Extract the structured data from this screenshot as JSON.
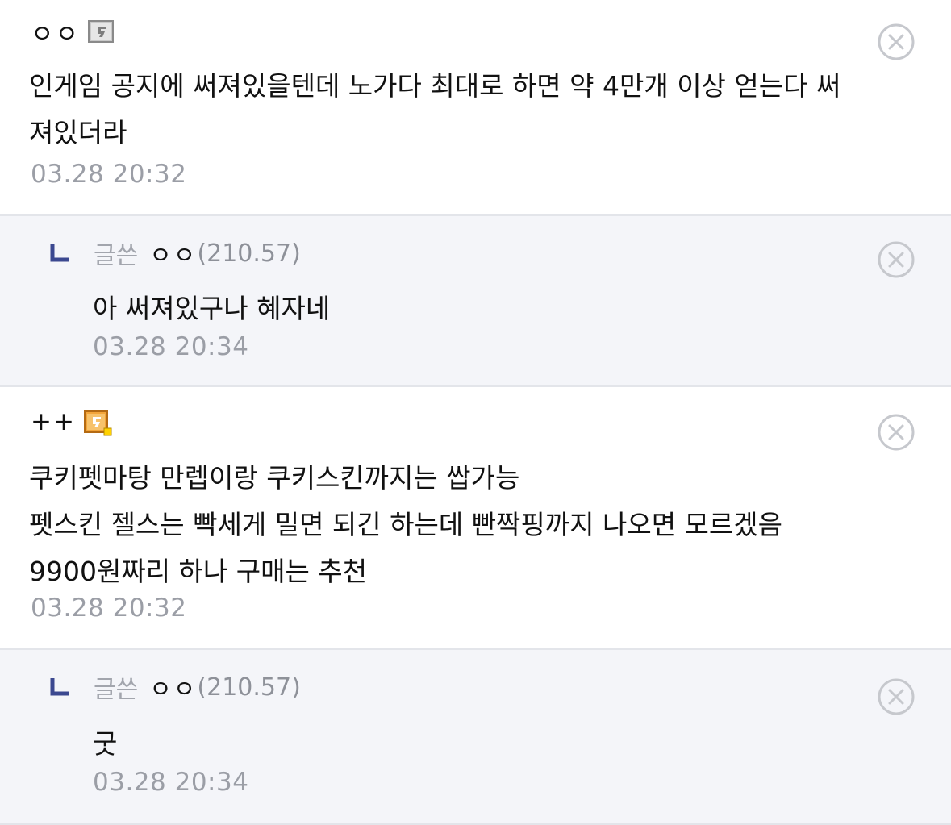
{
  "comments": [
    {
      "nickname": "ㅇㅇ",
      "gallog_icon": "gallog-gray-icon",
      "text": "인게임 공지에 써져있을텐데 노가다 최대로 하면 약 4만개 이상 얻는다 써\n져있더라",
      "time": "03.28 20:32",
      "reply": {
        "writer_tag": "글쓴",
        "nickname": "ㅇㅇ",
        "ip": "(210.57)",
        "text": "아 써져있구나 혜자네",
        "time": "03.28 20:34"
      }
    },
    {
      "nickname": "++",
      "gallog_icon": "gallog-orange-icon",
      "text": "쿠키펫마탕 만렙이랑 쿠키스킨까지는 쌉가능\n펫스킨 젤스는 빡세게 밀면 되긴 하는데 빤짝핑까지 나오면 모르겠음\n9900원짜리 하나 구매는 추천",
      "time": "03.28 20:32",
      "reply": {
        "writer_tag": "글쓴",
        "nickname": "ㅇㅇ",
        "ip": "(210.57)",
        "text": "굿",
        "time": "03.28 20:34"
      }
    }
  ],
  "colors": {
    "reply_bg": "#f4f5f9",
    "divider": "#e3e5ea",
    "meta_gray": "#9b9ea6",
    "reply_arrow": "#3b4890",
    "gallog_orange": "#f3a53a"
  },
  "icons": {
    "delete": "close-circle-icon",
    "reply": "reply-arrow-icon"
  }
}
